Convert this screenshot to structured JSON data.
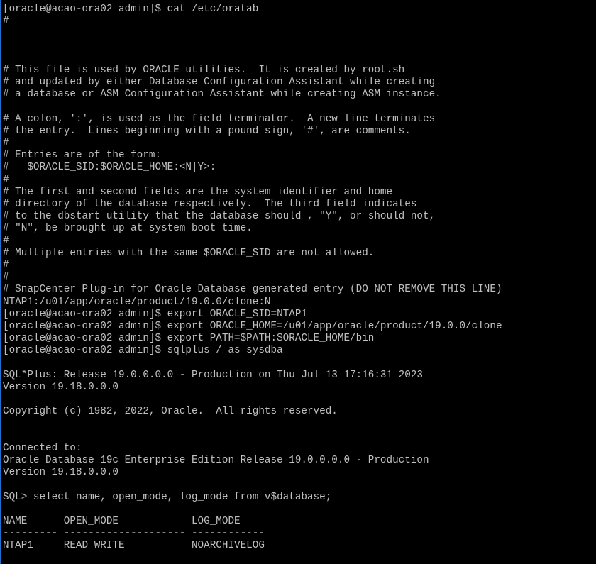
{
  "terminal": {
    "lines": [
      "[oracle@acao-ora02 admin]$ cat /etc/oratab",
      "#",
      "",
      "",
      "",
      "# This file is used by ORACLE utilities.  It is created by root.sh",
      "# and updated by either Database Configuration Assistant while creating",
      "# a database or ASM Configuration Assistant while creating ASM instance.",
      "",
      "# A colon, ':', is used as the field terminator.  A new line terminates",
      "# the entry.  Lines beginning with a pound sign, '#', are comments.",
      "#",
      "# Entries are of the form:",
      "#   $ORACLE_SID:$ORACLE_HOME:<N|Y>:",
      "#",
      "# The first and second fields are the system identifier and home",
      "# directory of the database respectively.  The third field indicates",
      "# to the dbstart utility that the database should , \"Y\", or should not,",
      "# \"N\", be brought up at system boot time.",
      "#",
      "# Multiple entries with the same $ORACLE_SID are not allowed.",
      "#",
      "#",
      "# SnapCenter Plug-in for Oracle Database generated entry (DO NOT REMOVE THIS LINE)",
      "NTAP1:/u01/app/oracle/product/19.0.0/clone:N",
      "[oracle@acao-ora02 admin]$ export ORACLE_SID=NTAP1",
      "[oracle@acao-ora02 admin]$ export ORACLE_HOME=/u01/app/oracle/product/19.0.0/clone",
      "[oracle@acao-ora02 admin]$ export PATH=$PATH:$ORACLE_HOME/bin",
      "[oracle@acao-ora02 admin]$ sqlplus / as sysdba",
      "",
      "SQL*Plus: Release 19.0.0.0.0 - Production on Thu Jul 13 17:16:31 2023",
      "Version 19.18.0.0.0",
      "",
      "Copyright (c) 1982, 2022, Oracle.  All rights reserved.",
      "",
      "",
      "Connected to:",
      "Oracle Database 19c Enterprise Edition Release 19.0.0.0.0 - Production",
      "Version 19.18.0.0.0",
      "",
      "SQL> select name, open_mode, log_mode from v$database;",
      "",
      "NAME      OPEN_MODE            LOG_MODE",
      "--------- -------------------- ------------",
      "NTAP1     READ WRITE           NOARCHIVELOG"
    ]
  },
  "colors": {
    "background": "#000000",
    "foreground": "#c0c0c0",
    "window_edge": "#1e6fd0"
  }
}
